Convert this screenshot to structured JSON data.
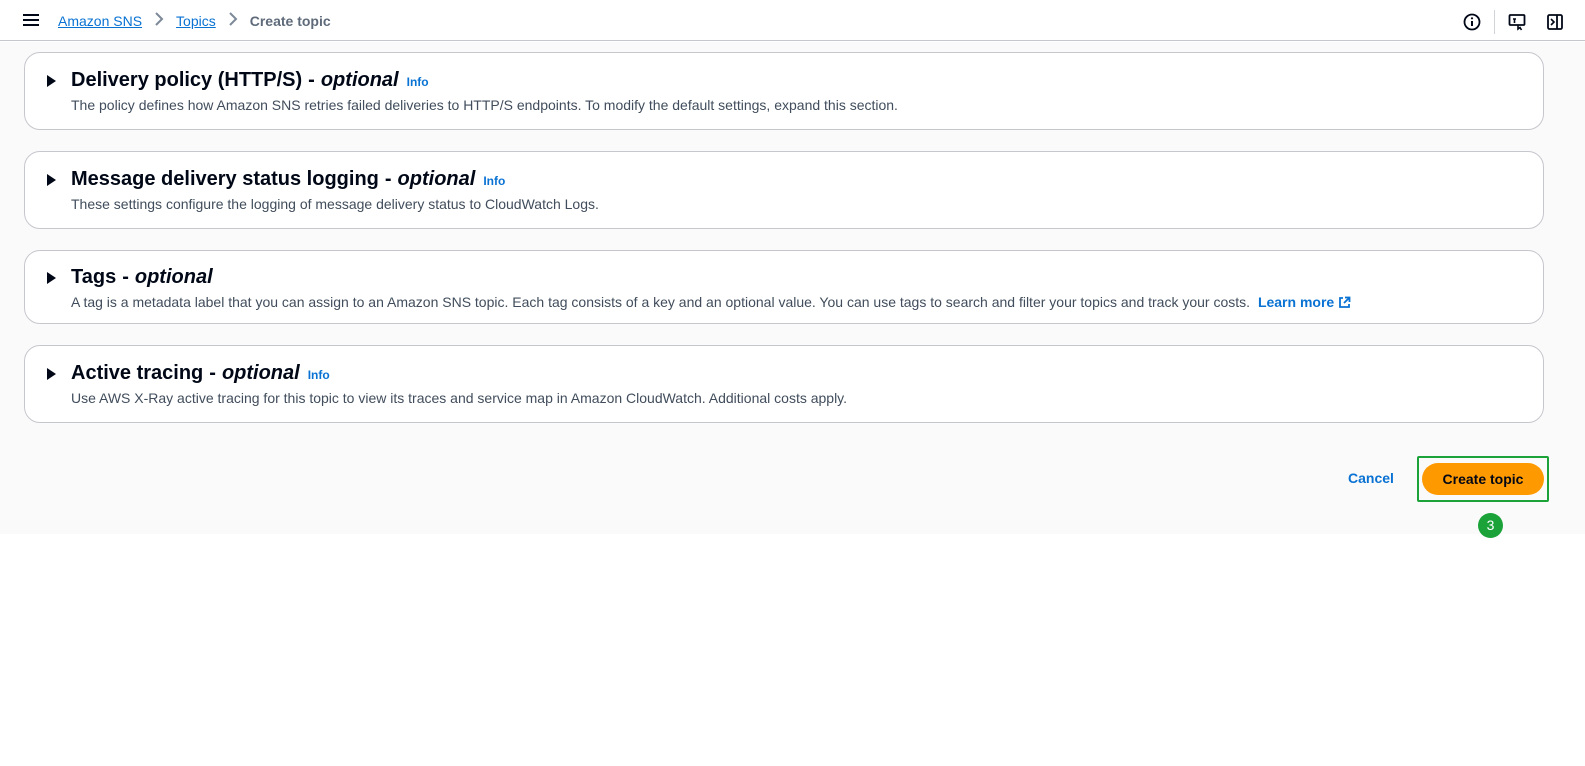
{
  "header": {
    "breadcrumbs": [
      {
        "label": "Amazon SNS"
      },
      {
        "label": "Topics"
      },
      {
        "label": "Create topic"
      }
    ]
  },
  "panels": [
    {
      "title": "Delivery policy (HTTP/S)",
      "optional": "optional",
      "info": "Info",
      "description": "The policy defines how Amazon SNS retries failed deliveries to HTTP/S endpoints. To modify the default settings, expand this section."
    },
    {
      "title": "Message delivery status logging",
      "optional": "optional",
      "info": "Info",
      "description": "These settings configure the logging of message delivery status to CloudWatch Logs."
    },
    {
      "title": "Tags",
      "optional": "optional",
      "description": "A tag is a metadata label that you can assign to an Amazon SNS topic. Each tag consists of a key and an optional value. You can use tags to search and filter your topics and track your costs.",
      "learn_more": "Learn more"
    },
    {
      "title": "Active tracing",
      "optional": "optional",
      "info": "Info",
      "description": "Use AWS X-Ray active tracing for this topic to view its traces and service map in Amazon CloudWatch. Additional costs apply."
    }
  ],
  "actions": {
    "cancel_label": "Cancel",
    "create_label": "Create topic",
    "step_number": "3"
  },
  "colors": {
    "accent": "#ff9900",
    "link": "#0972d3",
    "highlight": "#1ba33a"
  }
}
